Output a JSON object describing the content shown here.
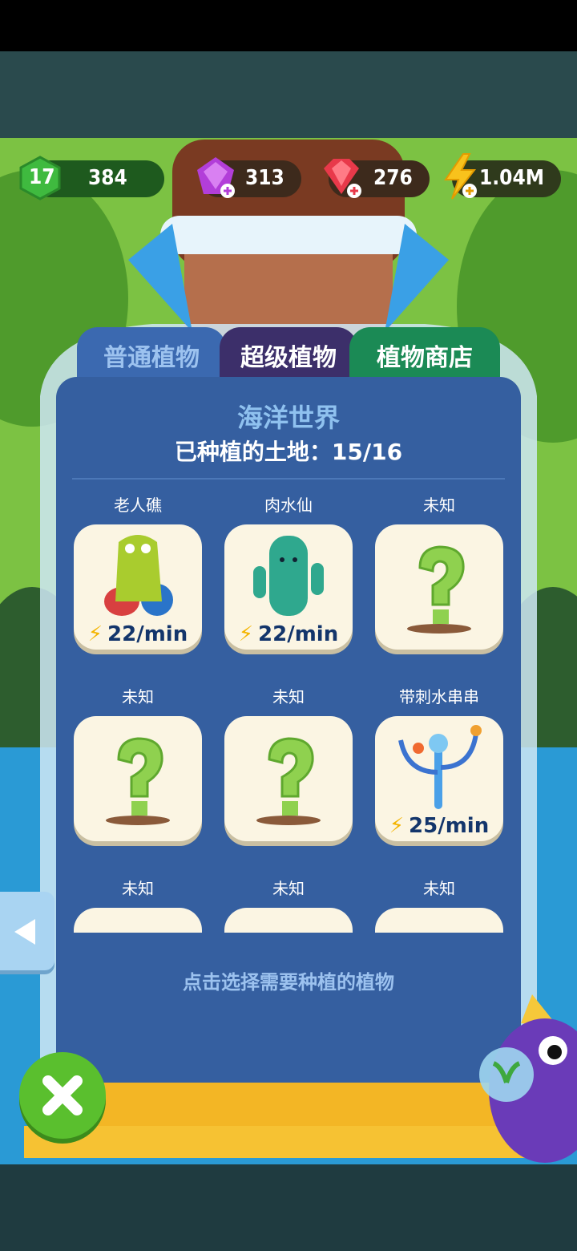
{
  "hud": {
    "level": "17",
    "leaves": "384",
    "gems_purple": "313",
    "gems_red": "276",
    "energy": "1.04M"
  },
  "tabs": [
    {
      "label": "普通植物"
    },
    {
      "label": "超级植物"
    },
    {
      "label": "植物商店"
    }
  ],
  "panel": {
    "title": "海洋世界",
    "land_status": "已种植的土地：15/16",
    "hint": "点击选择需要种植的植物"
  },
  "plants": [
    {
      "name": "老人礁",
      "rate": "22/min"
    },
    {
      "name": "肉水仙",
      "rate": "22/min"
    },
    {
      "name": "未知",
      "rate": ""
    },
    {
      "name": "未知",
      "rate": ""
    },
    {
      "name": "未知",
      "rate": ""
    },
    {
      "name": "带刺水串串",
      "rate": "25/min"
    },
    {
      "name": "未知",
      "rate": ""
    },
    {
      "name": "未知",
      "rate": ""
    },
    {
      "name": "未知",
      "rate": ""
    }
  ],
  "colors": {
    "panel_blue": "#355fa0",
    "tab_normal": "#3b69b0",
    "tab_super": "#3c2f6a",
    "tab_shop": "#1b8a55",
    "card": "#fbf5e3"
  }
}
